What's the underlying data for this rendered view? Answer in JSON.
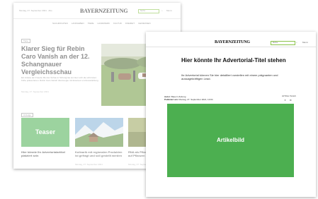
{
  "back": {
    "masthead": "BAYERNZEITUNG",
    "top_left": "Montag, 27. September 2021 · Abo",
    "search_placeholder": "Suche",
    "menu_label": "Menü",
    "nav": [
      "NACHRICHTEN",
      "LANDLEBEN",
      "TIERE",
      "HANDWERK",
      "KULTUR",
      "FREIZEIT",
      "GENIESSEN"
    ],
    "article_tag": "Tiere",
    "headline": "Klarer Sieg für Rebin Caro Vanish an der 12. Schangnauer Vergleichsschau",
    "teaser_text": "Ein Anlass der Freude: Bei der Schau in Schangnau konnten sich die schönsten Kühe präsentieren. Rebin Caro Vanish überzeugte mit Exterieur und Ausstrahlung.",
    "meta": "Montag, 27. September 2021",
    "cards": [
      {
        "tag": "Anzeige",
        "image_label": "Teaser",
        "title": "Hier könnte Ihr Advertorialartikel platziert sein",
        "meta": "Montag, 27. September 2021"
      },
      {
        "title": "Kulinarik mit regionalen Produkten ist gefragt und soll gestellt werden",
        "meta": "Montag, 27. September 2021"
      },
      {
        "title": "RNA als Pflanzenschutz: einfach auf Pflanzen",
        "meta": "Montag, 27. September 2021"
      }
    ]
  },
  "front": {
    "masthead": "BAYERNZEITUNG",
    "search_placeholder": "Suche",
    "menu_label": "Menü",
    "title": "Hier könnte Ihr Advertorial-Titel stehen",
    "lead": "Ihr Advertorial können Sie hier detailliert vorstellen mit einem prägnanten und aussagekräftigen Lead.",
    "author_label": "Autor:",
    "author_value": "Bauern Zeitung",
    "date_label": "Publiziert am:",
    "date_value": "Montag, 27. September 2021, 10:04",
    "share_label": "ARTIKEL TEILEN",
    "image_label": "Artikelbild"
  },
  "colors": {
    "accent_green": "#4caf50",
    "nav_red": "#c0392b"
  }
}
